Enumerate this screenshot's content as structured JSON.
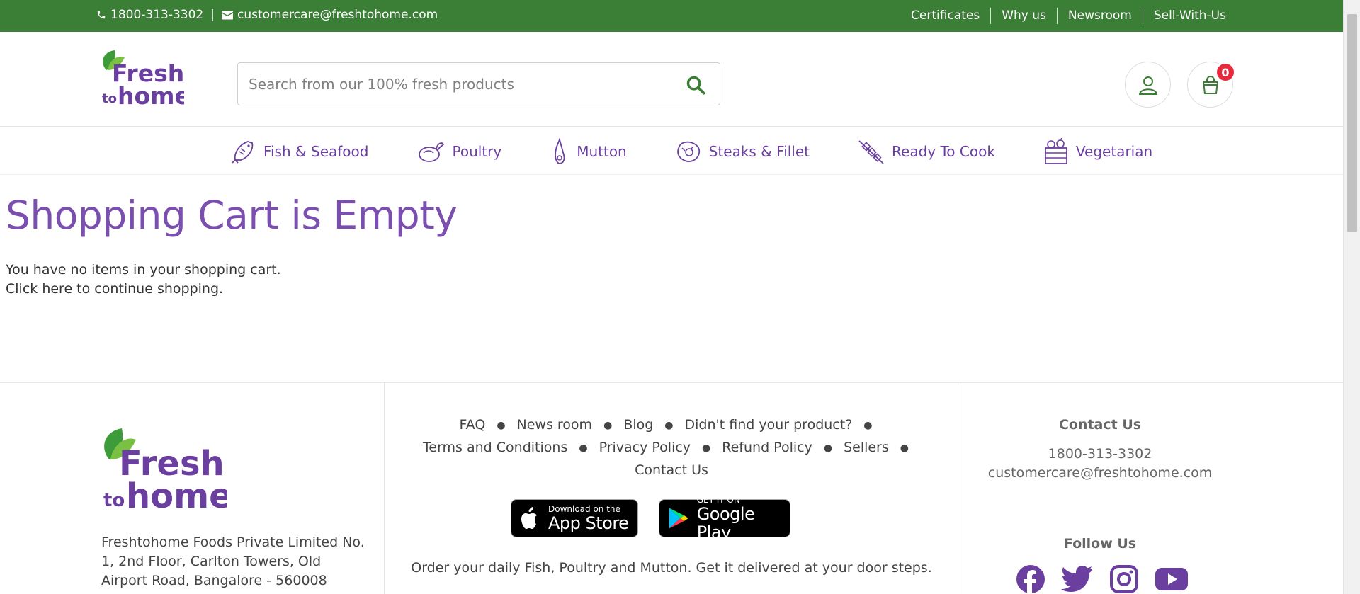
{
  "topbar": {
    "phone": "1800-313-3302",
    "divider": "|",
    "email": "customercare@freshtohome.com",
    "links": [
      "Certificates",
      "Why us",
      "Newsroom",
      "Sell-With-Us"
    ]
  },
  "header": {
    "logo_text_top": "Fresh",
    "logo_text_to": "to",
    "logo_text_bottom": "home",
    "search_placeholder": "Search from our 100% fresh products",
    "cart_count": "0"
  },
  "categories": [
    {
      "label": "Fish & Seafood",
      "icon": "fish-icon"
    },
    {
      "label": "Poultry",
      "icon": "chicken-icon"
    },
    {
      "label": "Mutton",
      "icon": "mutton-icon"
    },
    {
      "label": "Steaks & Fillet",
      "icon": "steak-icon"
    },
    {
      "label": "Ready To Cook",
      "icon": "skewer-icon"
    },
    {
      "label": "Vegetarian",
      "icon": "vegetable-basket-icon"
    }
  ],
  "main": {
    "title": "Shopping Cart is Empty",
    "line1": "You have no items in your shopping cart.",
    "line2_link": "Click here",
    "line2_rest": " to continue shopping."
  },
  "footer": {
    "address": "Freshtohome Foods Private Limited No. 1, 2nd Floor, Carlton Towers, Old Airport Road, Bangalore - 560008",
    "links": [
      "FAQ",
      "News room",
      "Blog",
      "Didn't find your product?",
      "Terms and Conditions",
      "Privacy Policy",
      "Refund Policy",
      "Sellers",
      "Contact Us"
    ],
    "appstore_small": "Download on the",
    "appstore_big": "App Store",
    "gplay_small": "GET IT ON",
    "gplay_big": "Google Play",
    "tagline": "Order your daily Fish, Poultry and Mutton. Get it delivered at your door steps.",
    "contact_title": "Contact Us",
    "contact_phone": "1800-313-3302",
    "contact_email": "customercare@freshtohome.com",
    "follow_title": "Follow Us",
    "social": [
      "facebook-icon",
      "twitter-icon",
      "instagram-icon",
      "youtube-icon"
    ]
  },
  "colors": {
    "topbar_green": "#3a7f35",
    "brand_purple": "#6b3fa0",
    "title_purple": "#7b4fb0",
    "badge_red": "#e8283b"
  }
}
